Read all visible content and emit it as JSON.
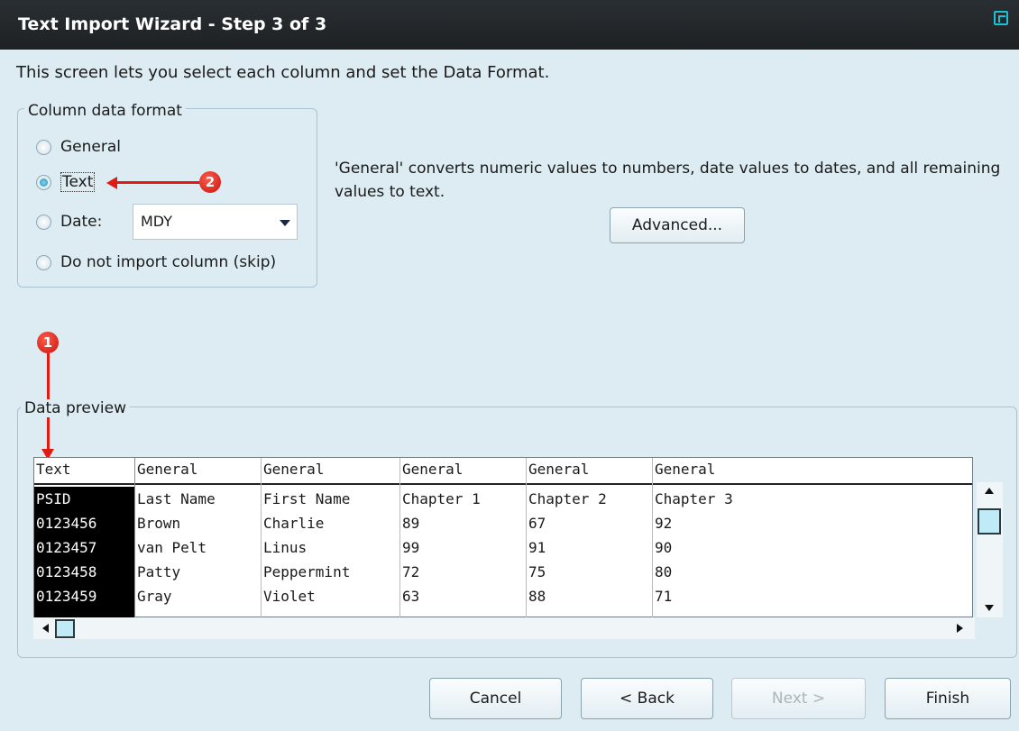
{
  "window": {
    "title": "Text Import Wizard - Step 3 of 3"
  },
  "instruction": "This screen lets you select each column and set the Data Format.",
  "column_format": {
    "legend": "Column data format",
    "options": [
      {
        "label": "General",
        "checked": false
      },
      {
        "label": "Text",
        "checked": true
      },
      {
        "label": "Date:",
        "checked": false
      },
      {
        "label": "Do not import column (skip)",
        "checked": false
      }
    ],
    "date_value": "MDY"
  },
  "description": "'General' converts numeric values to numbers, date values to dates, and all remaining values to text.",
  "advanced_label": "Advanced...",
  "preview": {
    "legend": "Data preview",
    "headers": [
      "Text",
      "General",
      "General",
      "General",
      "General",
      "General"
    ],
    "rows": [
      [
        "PSID",
        "Last Name",
        "First Name",
        "Chapter 1",
        "Chapter 2",
        "Chapter 3"
      ],
      [
        "0123456",
        "Brown",
        "Charlie",
        "89",
        "67",
        "92"
      ],
      [
        "0123457",
        "van Pelt",
        "Linus",
        "99",
        "91",
        "90"
      ],
      [
        "0123458",
        "Patty",
        "Peppermint",
        "72",
        "75",
        "80"
      ],
      [
        "0123459",
        "Gray",
        "Violet",
        "63",
        "88",
        "71"
      ]
    ]
  },
  "annotations": {
    "badge1": "1",
    "badge2": "2"
  },
  "buttons": {
    "cancel": "Cancel",
    "back": "< Back",
    "next": "Next >",
    "finish": "Finish"
  },
  "colors": {
    "background": "#dcecf2",
    "title_bar": "#1d2124",
    "annotation_red": "#e01b14",
    "selected_column_bg": "#000000",
    "selected_column_text": "#ffffff"
  }
}
